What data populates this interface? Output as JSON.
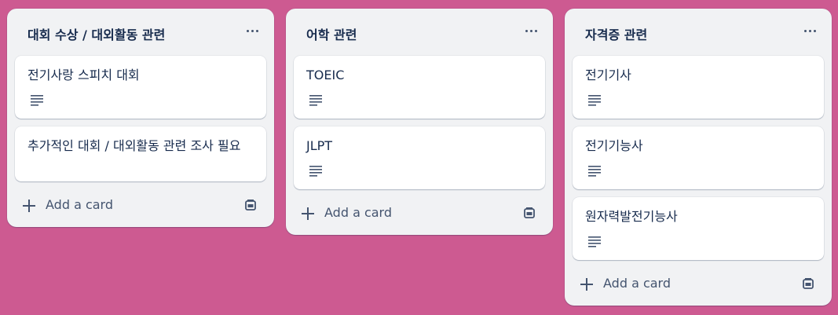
{
  "colors": {
    "board_background": "#cd5a91",
    "list_background": "#f1f2f4",
    "card_background": "#ffffff",
    "text_primary": "#172b4d",
    "text_secondary": "#44546f"
  },
  "lists": [
    {
      "title": "대회 수상 / 대외활동 관련",
      "menu_icon": "more-horizontal-icon",
      "cards": [
        {
          "title": "전기사랑 스피치 대회",
          "icon": "description-icon"
        },
        {
          "title": "추가적인 대회 / 대외활동 관련 조사 필요",
          "icon": ""
        }
      ],
      "add_card_label": "Add a card",
      "template_icon": "card-template-icon"
    },
    {
      "title": "어학 관련",
      "menu_icon": "more-horizontal-icon",
      "cards": [
        {
          "title": "TOEIC",
          "icon": "description-icon"
        },
        {
          "title": "JLPT",
          "icon": "description-icon"
        }
      ],
      "add_card_label": "Add a card",
      "template_icon": "card-template-icon"
    },
    {
      "title": "자격증 관련",
      "menu_icon": "more-horizontal-icon",
      "cards": [
        {
          "title": "전기기사",
          "icon": "description-icon"
        },
        {
          "title": "전기기능사",
          "icon": "description-icon"
        },
        {
          "title": "원자력발전기능사",
          "icon": "description-icon"
        }
      ],
      "add_card_label": "Add a card",
      "template_icon": "card-template-icon"
    }
  ]
}
